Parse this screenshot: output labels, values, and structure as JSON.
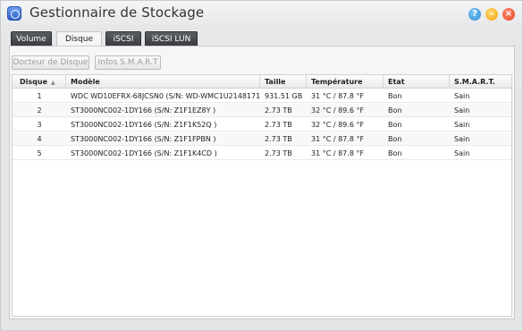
{
  "window": {
    "title": "Gestionnaire de Stockage",
    "controls": {
      "help": "?",
      "minimize": "–",
      "close": "×"
    }
  },
  "tabs": [
    {
      "label": "Volume",
      "active": false
    },
    {
      "label": "Disque",
      "active": true
    },
    {
      "label": "iSCSI",
      "active": false
    },
    {
      "label": "iSCSI LUN",
      "active": false
    }
  ],
  "toolbar": {
    "docteur_label": "Docteur de Disque",
    "smart_label": "Infos S.M.A.R.T"
  },
  "table": {
    "columns": [
      "Disque",
      "Modèle",
      "Taille",
      "Température",
      "Etat",
      "S.M.A.R.T."
    ],
    "sort_indicator": "▲",
    "rows": [
      [
        "1",
        "WDC WD10EFRX-68JCSN0 (S/N: WD-WMC1U2148171 )",
        "931.51 GB",
        "31 °C / 87.8 °F",
        "Bon",
        "Sain"
      ],
      [
        "2",
        "ST3000NC002-1DY166 (S/N: Z1F1EZ8Y )",
        "2.73 TB",
        "32 °C / 89.6 °F",
        "Bon",
        "Sain"
      ],
      [
        "3",
        "ST3000NC002-1DY166 (S/N: Z1F1K52Q )",
        "2.73 TB",
        "32 °C / 89.6 °F",
        "Bon",
        "Sain"
      ],
      [
        "4",
        "ST3000NC002-1DY166 (S/N: Z1F1FPBN )",
        "2.73 TB",
        "31 °C / 87.8 °F",
        "Bon",
        "Sain"
      ],
      [
        "5",
        "ST3000NC002-1DY166 (S/N: Z1F1K4CD )",
        "2.73 TB",
        "31 °C / 87.8 °F",
        "Bon",
        "Sain"
      ]
    ]
  },
  "colors": {
    "help": "#2a8fd6",
    "minimize": "#f1a515",
    "close": "#e4452a",
    "tab_dark": "#3a3c40"
  }
}
